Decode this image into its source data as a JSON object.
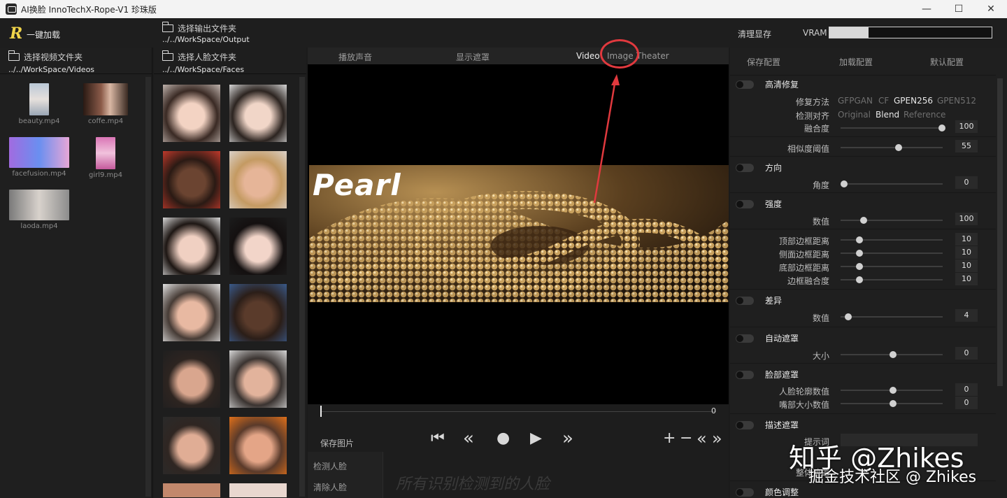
{
  "window": {
    "title": "AI换脸  InnoTechX-Rope-V1 珍珠版",
    "minimize": "—",
    "maximize": "☐",
    "close": "✕"
  },
  "topbar": {
    "logo": "R",
    "load_all": "一键加载",
    "output_folder_label": "选择输出文件夹",
    "output_path": "../../WorkSpace/Output",
    "clear_vram": "清理显存",
    "vram_label": "VRAM",
    "vram_usage": 0.24
  },
  "video_panel": {
    "folder_label": "选择视频文件夹",
    "path": "../../WorkSpace/Videos",
    "videos": [
      {
        "name": "beauty.mp4"
      },
      {
        "name": "coffe.mp4"
      },
      {
        "name": "facefusion.mp4"
      },
      {
        "name": "girl9.mp4"
      },
      {
        "name": "laoda.mp4"
      }
    ]
  },
  "face_panel": {
    "folder_label": "选择人脸文件夹",
    "path": "../../WorkSpace/Faces"
  },
  "center": {
    "tabs": {
      "audio": "播放声音",
      "mask": "显示遮罩",
      "video": "Video",
      "image": "Image",
      "theater": "Theater"
    },
    "preview_text": "Pearl",
    "frame": "0",
    "save_image": "保存图片",
    "detect_faces": "检测人脸",
    "clear_faces": "清除人脸",
    "detect_hint": "所有识别检测到的人脸"
  },
  "right": {
    "tabs": {
      "save": "保存配置",
      "load": "加载配置",
      "default": "默认配置"
    },
    "restore": {
      "title": "高清修复",
      "method_label": "修复方法",
      "methods": [
        "GFPGAN",
        "CF",
        "GPEN256",
        "GPEN512"
      ],
      "align_label": "检测对齐",
      "aligns": [
        "Original",
        "Blend",
        "Reference"
      ],
      "blend_label": "融合度",
      "blend_value": "100"
    },
    "threshold": {
      "label": "相似度阈值",
      "value": "55"
    },
    "orientation": {
      "title": "方向",
      "angle_label": "角度",
      "angle_value": "0"
    },
    "strength": {
      "title": "强度",
      "value_label": "数值",
      "value": "100"
    },
    "border": {
      "top_label": "顶部边框距离",
      "top": "10",
      "side_label": "侧面边框距离",
      "side": "10",
      "bottom_label": "底部边框距离",
      "bottom": "10",
      "blend_label": "边框融合度",
      "blend": "10"
    },
    "diff": {
      "title": "差异",
      "value_label": "数值",
      "value": "4"
    },
    "auto_mask": {
      "title": "自动遮罩",
      "size_label": "大小",
      "size": "0"
    },
    "face_mask": {
      "title": "脸部遮罩",
      "contour_label": "人脸轮廓数值",
      "contour": "0",
      "mouth_label": "嘴部大小数值",
      "mouth": "0"
    },
    "describe_mask": {
      "title": "描述遮罩",
      "prompt_label": "提示词",
      "overall_label": "整体遮罩"
    },
    "color": {
      "title": "颜色调整"
    }
  },
  "watermark": {
    "line1": "知乎 @Zhikes",
    "line2": "掘金技术社区 @ Zhikes"
  },
  "colors": {
    "accent_logo": "#f1d54a",
    "annotation": "#e0393e",
    "background": "#1b1b1b"
  }
}
